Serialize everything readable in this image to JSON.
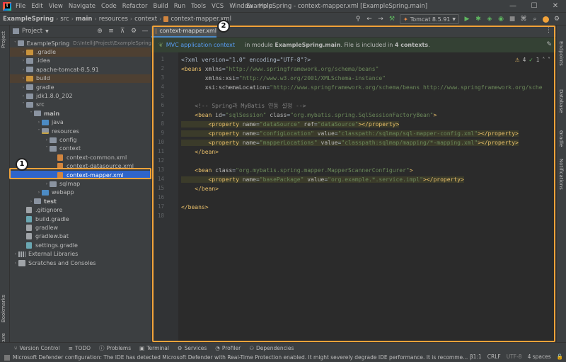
{
  "menubar": {
    "items": [
      "File",
      "Edit",
      "View",
      "Navigate",
      "Code",
      "Refactor",
      "Build",
      "Run",
      "Tools",
      "VCS",
      "Window",
      "Help"
    ],
    "window_title": "ExampleSpring - context-mapper.xml [ExampleSpring.main]",
    "controls": [
      "—",
      "☐",
      "✕"
    ]
  },
  "navbar": {
    "breadcrumbs": [
      "ExampleSpring",
      "src",
      "main",
      "resources",
      "context",
      "context-mapper.xml"
    ],
    "run_config": "Tomcat 8.5.91"
  },
  "left_strip": {
    "tabs": [
      "Project",
      "Bookmarks",
      "Structure"
    ]
  },
  "right_strip": {
    "tabs": [
      "Endpoints",
      "Database",
      "Gradle",
      "Notifications"
    ]
  },
  "project": {
    "title": "Project",
    "tree": [
      {
        "label": "ExampleSpring",
        "extra": "D:\\IntelliJProject\\ExampleSpring",
        "indent": 0,
        "kind": "module",
        "expanded": true
      },
      {
        "label": ".gradle",
        "indent": 1,
        "kind": "folder-orange",
        "expanded": false,
        "excluded": true
      },
      {
        "label": ".idea",
        "indent": 1,
        "kind": "folder",
        "expanded": false
      },
      {
        "label": "apache-tomcat-8.5.91",
        "indent": 1,
        "kind": "folder",
        "expanded": false
      },
      {
        "label": "build",
        "indent": 1,
        "kind": "folder-orange",
        "expanded": false,
        "excluded": true
      },
      {
        "label": "gradle",
        "indent": 1,
        "kind": "folder",
        "expanded": false
      },
      {
        "label": "jdk1.8.0_202",
        "indent": 1,
        "kind": "folder",
        "expanded": false
      },
      {
        "label": "src",
        "indent": 1,
        "kind": "folder",
        "expanded": true
      },
      {
        "label": "main",
        "indent": 2,
        "kind": "folder",
        "expanded": true,
        "bold": true
      },
      {
        "label": "java",
        "indent": 3,
        "kind": "folder-blue",
        "expanded": false
      },
      {
        "label": "resources",
        "indent": 3,
        "kind": "folder-resource",
        "expanded": true
      },
      {
        "label": "config",
        "indent": 4,
        "kind": "folder",
        "expanded": false
      },
      {
        "label": "context",
        "indent": 4,
        "kind": "folder",
        "expanded": true
      },
      {
        "label": "context-common.xml",
        "indent": 5,
        "kind": "xml"
      },
      {
        "label": "context-datasource.xml",
        "indent": 5,
        "kind": "xml"
      },
      {
        "label": "context-mapper.xml",
        "indent": 5,
        "kind": "xml",
        "selected": true
      },
      {
        "label": "sqlmap",
        "indent": 4,
        "kind": "folder",
        "expanded": false
      },
      {
        "label": "webapp",
        "indent": 3,
        "kind": "folder-blue",
        "expanded": false
      },
      {
        "label": "test",
        "indent": 2,
        "kind": "folder",
        "expanded": false,
        "bold": true
      },
      {
        "label": ".gitignore",
        "indent": 1,
        "kind": "text"
      },
      {
        "label": "build.gradle",
        "indent": 1,
        "kind": "gradle"
      },
      {
        "label": "gradlew",
        "indent": 1,
        "kind": "text"
      },
      {
        "label": "gradlew.bat",
        "indent": 1,
        "kind": "text"
      },
      {
        "label": "settings.gradle",
        "indent": 1,
        "kind": "gradle"
      },
      {
        "label": "External Libraries",
        "indent": 0,
        "kind": "lib",
        "expanded": false
      },
      {
        "label": "Scratches and Consoles",
        "indent": 0,
        "kind": "scratch",
        "expanded": false
      }
    ]
  },
  "editor": {
    "tab_label": "context-mapper.xml",
    "banner": {
      "link": "MVC application context",
      "msg_prefix": "in module ",
      "module": "ExampleSpring.main",
      "msg_middle": ". File is included in ",
      "contexts": "4 contexts",
      "msg_suffix": "."
    },
    "inspections": {
      "warnings": "4",
      "checks": "1"
    },
    "line_numbers": [
      "1",
      "2",
      "3",
      "4",
      "5",
      "6",
      "7",
      "8",
      "9",
      "10",
      "11",
      "12",
      "13",
      "14",
      "15",
      "16",
      "17",
      "18"
    ],
    "lines": [
      [
        {
          "t": "<?xml version=\"1.0\" encoding=\"UTF-8\"?>",
          "c": "pl"
        }
      ],
      [
        {
          "t": "<beans ",
          "c": "kw"
        },
        {
          "t": "xmlns",
          "c": "attr"
        },
        {
          "t": "=",
          "c": "pl"
        },
        {
          "t": "\"http://www.springframework.org/schema/beans\"",
          "c": "val"
        }
      ],
      [
        {
          "t": "       xmlns:xsi",
          "c": "attr"
        },
        {
          "t": "=",
          "c": "pl"
        },
        {
          "t": "\"http://www.w3.org/2001/XMLSchema-instance\"",
          "c": "val"
        }
      ],
      [
        {
          "t": "       xsi:schemaLocation",
          "c": "attr"
        },
        {
          "t": "=",
          "c": "pl"
        },
        {
          "t": "\"http://www.springframework.org/schema/beans http://www.springframework.org/sche",
          "c": "val"
        }
      ],
      [],
      [
        {
          "t": "    <!-- Spring과 MyBatis 연동 설정 -->",
          "c": "cm"
        }
      ],
      [
        {
          "t": "    <bean ",
          "c": "kw"
        },
        {
          "t": "id",
          "c": "attr"
        },
        {
          "t": "=",
          "c": "pl"
        },
        {
          "t": "\"sqlSession\"",
          "c": "val"
        },
        {
          "t": " class",
          "c": "attr"
        },
        {
          "t": "=",
          "c": "pl"
        },
        {
          "t": "\"org.mybatis.spring.SqlSessionFactoryBean\"",
          "c": "val"
        },
        {
          "t": ">",
          "c": "kw"
        }
      ],
      [
        {
          "t": "        <property ",
          "c": "kw",
          "h": 1
        },
        {
          "t": "name",
          "c": "attr",
          "h": 1
        },
        {
          "t": "=",
          "c": "pl",
          "h": 1
        },
        {
          "t": "\"dataSource\"",
          "c": "val",
          "h": 1
        },
        {
          "t": " ref",
          "c": "attr",
          "h": 1
        },
        {
          "t": "=",
          "c": "pl",
          "h": 1
        },
        {
          "t": "\"dataSource\"",
          "c": "val",
          "h": 1
        },
        {
          "t": "></property>",
          "c": "kw",
          "h": 1
        }
      ],
      [
        {
          "t": "        <property ",
          "c": "kw",
          "h": 1
        },
        {
          "t": "name",
          "c": "attr",
          "h": 1
        },
        {
          "t": "=",
          "c": "pl",
          "h": 1
        },
        {
          "t": "\"configLocation\"",
          "c": "val",
          "h": 1
        },
        {
          "t": " value",
          "c": "attr",
          "h": 1
        },
        {
          "t": "=",
          "c": "pl",
          "h": 1
        },
        {
          "t": "\"classpath:/sqlmap/sql-mapper-config.xml\"",
          "c": "val",
          "h": 1
        },
        {
          "t": "></property>",
          "c": "kw",
          "h": 1
        }
      ],
      [
        {
          "t": "        <property ",
          "c": "kw",
          "h": 1
        },
        {
          "t": "name",
          "c": "attr",
          "h": 1
        },
        {
          "t": "=",
          "c": "pl",
          "h": 1
        },
        {
          "t": "\"mapperLocations\"",
          "c": "val",
          "h": 1
        },
        {
          "t": " value",
          "c": "attr",
          "h": 1
        },
        {
          "t": "=",
          "c": "pl",
          "h": 1
        },
        {
          "t": "\"classpath:sqlmap/mapping/*-mapping.xml\"",
          "c": "val",
          "h": 1
        },
        {
          "t": "></property>",
          "c": "kw",
          "h": 1
        }
      ],
      [
        {
          "t": "    </bean>",
          "c": "kw"
        }
      ],
      [],
      [
        {
          "t": "    <bean ",
          "c": "kw"
        },
        {
          "t": "class",
          "c": "attr"
        },
        {
          "t": "=",
          "c": "pl"
        },
        {
          "t": "\"org.mybatis.spring.mapper.MapperScannerConfigurer\"",
          "c": "val"
        },
        {
          "t": ">",
          "c": "kw"
        }
      ],
      [
        {
          "t": "        <property ",
          "c": "kw",
          "h": 1
        },
        {
          "t": "name",
          "c": "attr",
          "h": 1
        },
        {
          "t": "=",
          "c": "pl",
          "h": 1
        },
        {
          "t": "\"basePackage\"",
          "c": "val",
          "h": 1
        },
        {
          "t": " value",
          "c": "attr",
          "h": 1
        },
        {
          "t": "=",
          "c": "pl",
          "h": 1
        },
        {
          "t": "\"org.example.*.service.impl\"",
          "c": "val",
          "h": 1
        },
        {
          "t": "></property>",
          "c": "kw",
          "h": 1
        }
      ],
      [
        {
          "t": "    </bean>",
          "c": "kw"
        }
      ],
      [],
      [
        {
          "t": "</beans>",
          "c": "kw"
        }
      ],
      []
    ]
  },
  "toolwindows": [
    "Version Control",
    "TODO",
    "Problems",
    "Terminal",
    "Services",
    "Profiler",
    "Dependencies"
  ],
  "status": {
    "message": "Microsoft Defender configuration: The IDE has detected Microsoft Defender with Real-Time Protection enabled. It might severely degrade IDE performance. It is recomme... (4 minutes a",
    "position": "31:1",
    "line_sep": "CRLF",
    "encoding": "UTF-8",
    "indent": "4 spaces"
  },
  "callouts": [
    "1",
    "2"
  ],
  "colors": {
    "callout": "#f2a33a",
    "selection": "#2f65ca",
    "banner": "#344134"
  }
}
